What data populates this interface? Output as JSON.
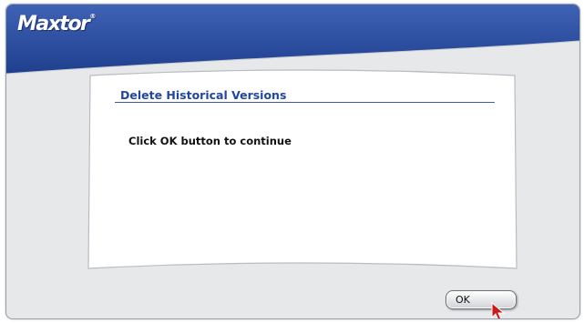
{
  "window": {
    "logo_text": "Maxtor",
    "logo_mark": "®"
  },
  "dialog": {
    "title": "Delete Historical Versions",
    "message": "Click OK button to continue"
  },
  "buttons": {
    "ok_label": "OK"
  },
  "colors": {
    "header_blue": "#2b4d9c",
    "title_blue": "#2346a0",
    "background_gray": "#e7e8ea",
    "cursor_red": "#cc1a1a"
  },
  "icons": {
    "cursor": "arrow-pointer-icon"
  }
}
